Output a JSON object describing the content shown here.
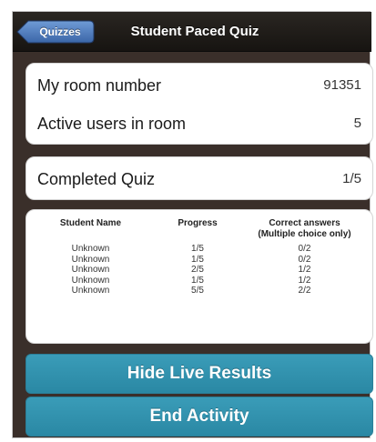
{
  "nav": {
    "back_label": "Quizzes",
    "title": "Student Paced Quiz"
  },
  "room_card": {
    "room_label": "My room number",
    "room_value": "91351",
    "users_label": "Active users in room",
    "users_value": "5"
  },
  "completed_card": {
    "label": "Completed Quiz",
    "value": "1/5"
  },
  "results": {
    "headers": {
      "name": "Student Name",
      "progress": "Progress",
      "correct": "Correct answers (Multiple choice only)"
    },
    "rows": [
      {
        "name": "Unknown",
        "progress": "1/5",
        "correct": "0/2"
      },
      {
        "name": "Unknown",
        "progress": "1/5",
        "correct": "0/2"
      },
      {
        "name": "Unknown",
        "progress": "2/5",
        "correct": "1/2"
      },
      {
        "name": "Unknown",
        "progress": "1/5",
        "correct": "1/2"
      },
      {
        "name": "Unknown",
        "progress": "5/5",
        "correct": "2/2"
      }
    ]
  },
  "buttons": {
    "hide_results": "Hide Live Results",
    "end_activity": "End Activity"
  },
  "colors": {
    "nav_bar": "#1e1a17",
    "back_button": "#4a78b8",
    "background": "#3a2f2a",
    "action_button": "#3196b2"
  }
}
